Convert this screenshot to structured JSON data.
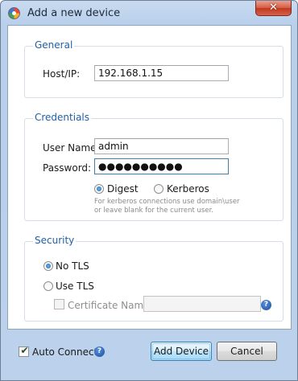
{
  "window": {
    "title": "Add a new device",
    "close_glyph": "✕"
  },
  "general": {
    "group_title": "General",
    "host_label": "Host/IP:",
    "host_value": "192.168.1.15"
  },
  "credentials": {
    "group_title": "Credentials",
    "user_label": "User Name:",
    "user_value": "admin",
    "password_label": "Password:",
    "password_mask": "●●●●●●●●●●",
    "auth_options": [
      {
        "label": "Digest",
        "selected": true
      },
      {
        "label": "Kerberos",
        "selected": false
      }
    ],
    "hint_line1": "For kerberos connections use domain\\user",
    "hint_line2": "or leave blank for the current user."
  },
  "security": {
    "group_title": "Security",
    "tls_options": [
      {
        "label": "No TLS",
        "selected": true
      },
      {
        "label": "Use TLS",
        "selected": false
      }
    ],
    "cert_label": "Certificate Name:",
    "cert_value": "",
    "cert_checked": false
  },
  "footer": {
    "auto_connect_label": "Auto Connect",
    "auto_connect_checked": true,
    "add_button": "Add Device",
    "cancel_button": "Cancel"
  },
  "icons": {
    "app": "app-logo-icon",
    "help": "help-icon",
    "close": "close-icon"
  },
  "colors": {
    "accent": "#1f5fa8",
    "window_frame": "#bcd1eb",
    "close": "#c8432a"
  }
}
